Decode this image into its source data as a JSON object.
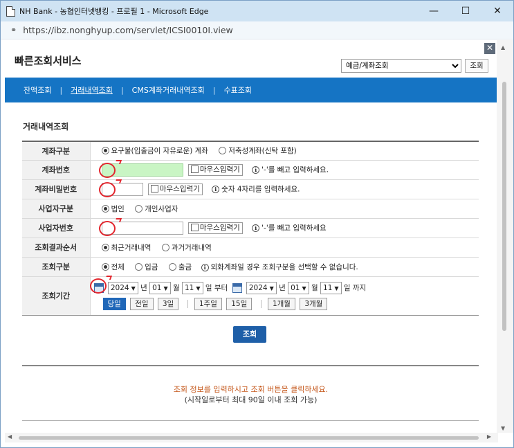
{
  "window": {
    "title": "NH Bank - 농협인터넷뱅킹 - 프로필 1 - Microsoft Edge",
    "minimize": "—",
    "maximize": "☐",
    "close": "✕"
  },
  "address": {
    "url": "https://ibz.nonghyup.com/servlet/ICSI0010I.view"
  },
  "popup": {
    "title": "빠른조회서비스",
    "select_value": "예금/계좌조회",
    "search_button": "조회",
    "close_icon": "✕"
  },
  "nav": {
    "items": [
      "잔액조회",
      "거래내역조회",
      "CMS계좌거래내역조회",
      "수표조회"
    ],
    "separator": "|"
  },
  "section_title": "거래내역조회",
  "form": {
    "account_type": {
      "label": "계좌구분",
      "opt1": "요구불(입출금이 자유로운) 계좌",
      "opt2": "저축성계좌(신탁 포함)"
    },
    "account_no": {
      "label": "계좌번호",
      "mouse": "마우스입력기",
      "hint": "'-'를 빼고 입력하세요."
    },
    "password": {
      "label": "계좌비밀번호",
      "mouse": "마우스입력기",
      "hint": "숫자 4자리를 입력하세요."
    },
    "biz_type": {
      "label": "사업자구분",
      "opt1": "법인",
      "opt2": "개인사업자"
    },
    "biz_no": {
      "label": "사업자번호",
      "mouse": "마우스입력기",
      "hint": "'-'를 빼고 입력하세요"
    },
    "order": {
      "label": "조회결과순서",
      "opt1": "최근거래내역",
      "opt2": "과거거래내역"
    },
    "inq_type": {
      "label": "조회구분",
      "opt1": "전체",
      "opt2": "입금",
      "opt3": "출금",
      "hint": "외화계좌일 경우 조회구분을 선택할 수 없습니다."
    },
    "period": {
      "label": "조회기간",
      "from_year": "2024",
      "from_month": "01",
      "from_day": "11",
      "to_year": "2024",
      "to_month": "01",
      "to_day": "11",
      "year_unit": "년",
      "month_unit": "월",
      "from_suffix": "일 부터",
      "to_suffix": "일 까지",
      "buttons": [
        "당일",
        "전일",
        "3일",
        "1주일",
        "15일",
        "1개월",
        "3개월"
      ]
    }
  },
  "submit_label": "조회",
  "message": {
    "line1": "조회 정보를 입력하시고 조회 버튼을 클릭하세요.",
    "line2": "(시작일로부터 최대 90일 이내 조회 가능)"
  },
  "icons": {
    "info": "ℹ",
    "lock": "🔒",
    "dropdown": "▼"
  }
}
